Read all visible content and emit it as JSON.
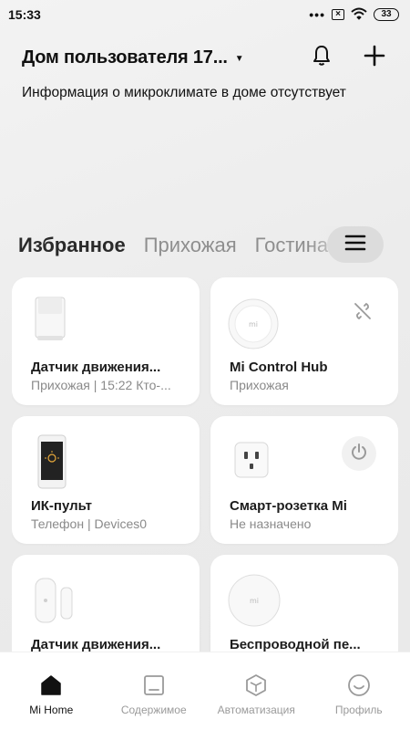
{
  "status_bar": {
    "time": "15:33",
    "dots": "•••",
    "sim_icon_glyph": "×",
    "battery": "33",
    "icons": [
      "dots-icon",
      "no-sim-icon",
      "wifi-icon",
      "battery-icon"
    ]
  },
  "header": {
    "home_title": "Дом пользователя 17...",
    "caret": "▼",
    "subtitle": "Информация о микроклимате в доме отсутствует",
    "actions": [
      "bell-icon",
      "plus-icon"
    ]
  },
  "tabs": {
    "items": [
      {
        "label": "Избранное",
        "active": true
      },
      {
        "label": "Прихожая",
        "active": false
      },
      {
        "label": "Гостиная",
        "active": false
      }
    ],
    "menu_icon": "menu-icon"
  },
  "devices": [
    {
      "name": "Датчик движения...",
      "sub": "Прихожая | 15:22 Кто-...",
      "icon": "motion-sensor-icon"
    },
    {
      "name": "Mi Control Hub",
      "sub": "Прихожая",
      "icon": "hub-icon",
      "status_icon": "offline-link-icon"
    },
    {
      "name": "ИК-пульт",
      "sub": "Телефон | Devices0",
      "icon": "phone-ir-icon"
    },
    {
      "name": "Смарт-розетка Mi",
      "sub": "Не назначено",
      "icon": "smart-plug-icon",
      "status_icon": "power-icon"
    },
    {
      "name": "Датчик движения...",
      "sub": "",
      "icon": "door-sensor-icon"
    },
    {
      "name": "Беспроводной пе...",
      "sub": "",
      "icon": "wireless-switch-icon"
    }
  ],
  "bottom_nav": [
    {
      "label": "Mi Home",
      "icon": "home-icon",
      "active": true
    },
    {
      "label": "Содержимое",
      "icon": "content-icon",
      "active": false
    },
    {
      "label": "Автоматизация",
      "icon": "automation-icon",
      "active": false
    },
    {
      "label": "Профиль",
      "icon": "profile-icon",
      "active": false
    }
  ],
  "colors": {
    "background": "#ececec",
    "card": "#ffffff",
    "text_primary": "#1c1c1c",
    "text_secondary": "#8a8a8a",
    "menu_button": "#dcdcdc"
  }
}
